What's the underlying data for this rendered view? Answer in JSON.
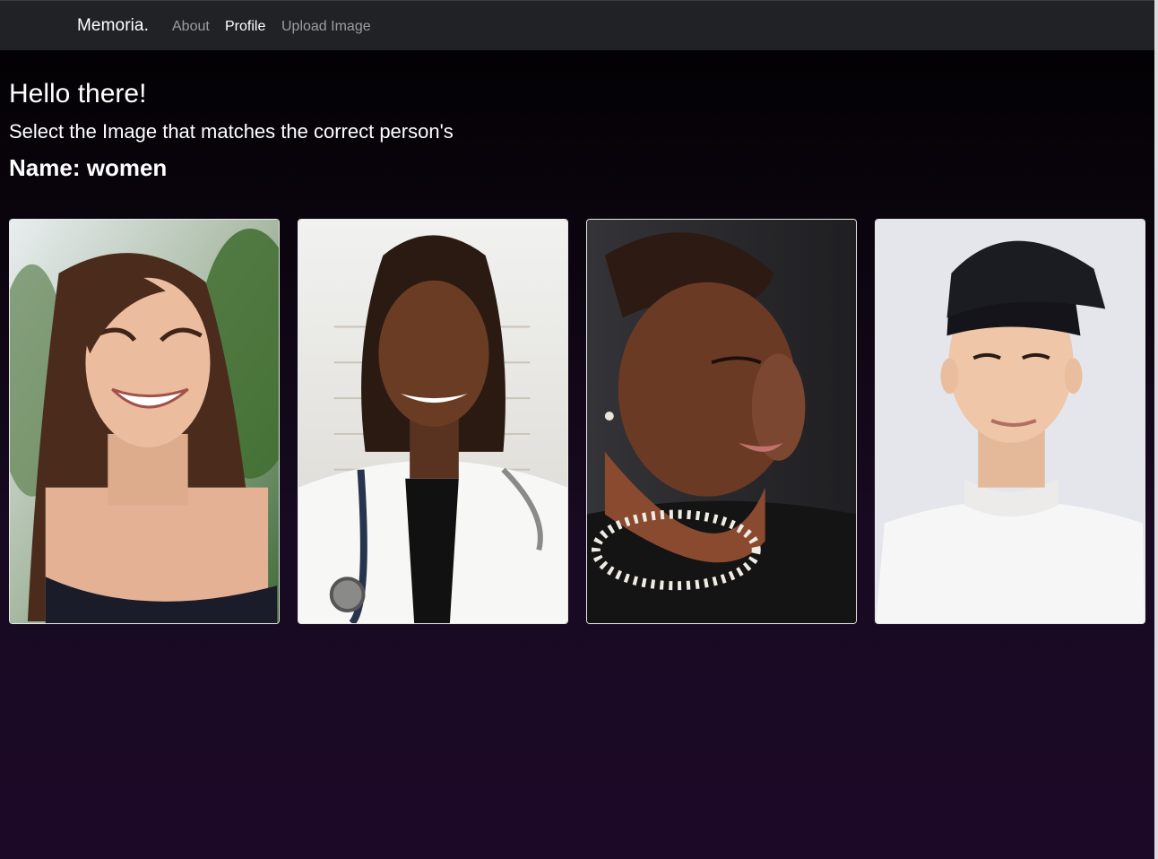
{
  "navbar": {
    "brand": "Memoria.",
    "links": [
      {
        "label": "About",
        "active": false
      },
      {
        "label": "Profile",
        "active": true
      },
      {
        "label": "Upload Image",
        "active": false
      }
    ]
  },
  "main": {
    "greeting": "Hello there!",
    "instruction": "Select the Image that matches the correct person's",
    "name_label": "Name:",
    "name_value": "women"
  },
  "cards": [
    {
      "icon": "portrait-photo-icon"
    },
    {
      "icon": "portrait-photo-icon"
    },
    {
      "icon": "portrait-photo-icon"
    },
    {
      "icon": "portrait-photo-icon"
    }
  ],
  "colors": {
    "navbar_bg": "#212225",
    "nav_active": "#ffffff",
    "nav_inactive": "#8c8c8f",
    "page_top": "#000000",
    "page_bottom": "#1c0928"
  }
}
